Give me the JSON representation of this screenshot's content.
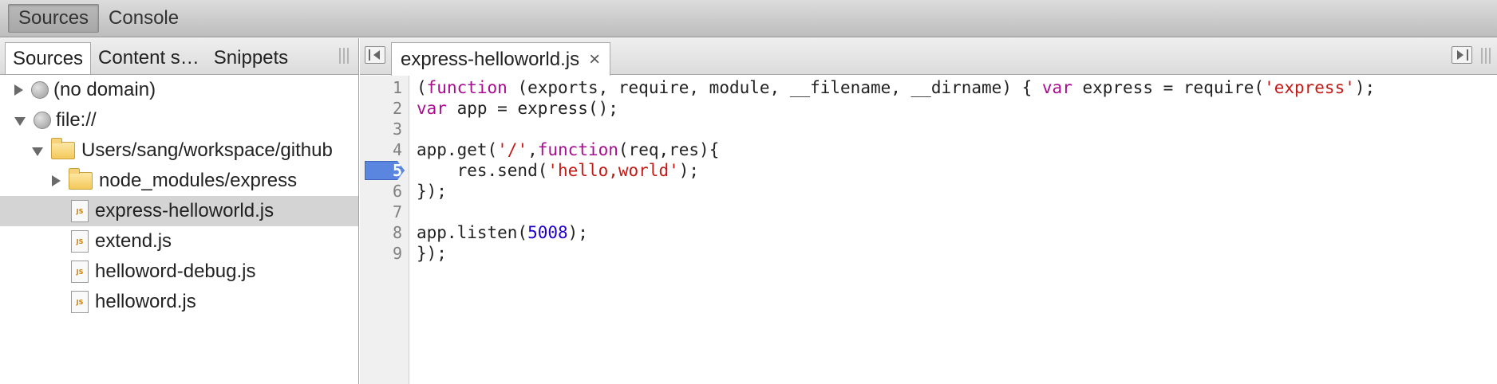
{
  "toolbar": {
    "tabs": [
      {
        "label": "Sources",
        "active": true
      },
      {
        "label": "Console",
        "active": false
      }
    ]
  },
  "navigator": {
    "tabs": [
      {
        "label": "Sources",
        "active": true
      },
      {
        "label": "Content s…",
        "active": false
      },
      {
        "label": "Snippets",
        "active": false
      }
    ],
    "tree": [
      {
        "label": "(no domain)",
        "icon": "globe-icon",
        "expander": "collapsed"
      },
      {
        "label": "file://",
        "icon": "globe-icon",
        "expander": "expanded"
      },
      {
        "label": "Users/sang/workspace/github",
        "icon": "folder-icon",
        "expander": "expanded"
      },
      {
        "label": "node_modules/express",
        "icon": "folder-icon",
        "expander": "collapsed"
      },
      {
        "label": "express-helloworld.js",
        "icon": "js-file-icon",
        "selected": true
      },
      {
        "label": "extend.js",
        "icon": "js-file-icon"
      },
      {
        "label": "helloword-debug.js",
        "icon": "js-file-icon"
      },
      {
        "label": "helloword.js",
        "icon": "js-file-icon"
      }
    ],
    "js_badge": "JS"
  },
  "editor": {
    "open_file": "express-helloworld.js",
    "close_glyph": "×",
    "breakpoint_line": 5,
    "line_numbers": [
      "1",
      "2",
      "3",
      "4",
      "5",
      "6",
      "7",
      "8",
      "9"
    ],
    "code": [
      [
        {
          "t": "("
        },
        {
          "t": "function",
          "c": "kw"
        },
        {
          "t": " (exports, require, module, __filename, __dirname) { "
        },
        {
          "t": "var",
          "c": "kw"
        },
        {
          "t": " express = require("
        },
        {
          "t": "'express'",
          "c": "str"
        },
        {
          "t": ");"
        }
      ],
      [
        {
          "t": "var",
          "c": "kw"
        },
        {
          "t": " app = express();"
        }
      ],
      [
        {
          "t": ""
        }
      ],
      [
        {
          "t": "app.get("
        },
        {
          "t": "'/'",
          "c": "str"
        },
        {
          "t": ","
        },
        {
          "t": "function",
          "c": "kw"
        },
        {
          "t": "(req,res){"
        }
      ],
      [
        {
          "t": "    res.send("
        },
        {
          "t": "'hello,world'",
          "c": "str"
        },
        {
          "t": ");"
        }
      ],
      [
        {
          "t": "});"
        }
      ],
      [
        {
          "t": ""
        }
      ],
      [
        {
          "t": "app.listen("
        },
        {
          "t": "5008",
          "c": "num"
        },
        {
          "t": ");"
        }
      ],
      [
        {
          "t": "});"
        }
      ]
    ]
  },
  "colors": {
    "keyword": "#aa0d91",
    "string": "#c41a16",
    "number": "#1c00cf",
    "breakpoint": "#5b86e0",
    "selected_row": "#d4d4d4"
  }
}
